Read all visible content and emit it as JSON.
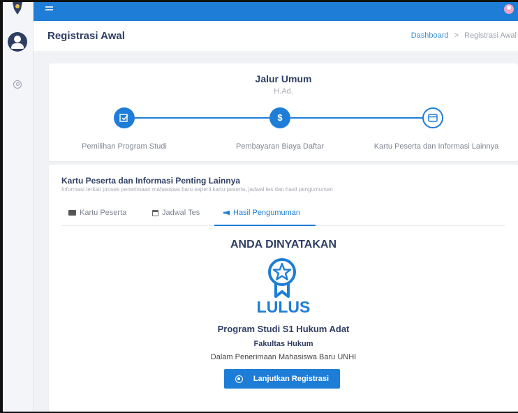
{
  "header": {
    "title": "Registrasi Awal"
  },
  "breadcrumb": {
    "home": "Dashboard",
    "separator": ">",
    "current": "Registrasi Awal"
  },
  "jalur": {
    "title": "Jalur Umum",
    "subtitle": "H.Ad."
  },
  "steps": [
    {
      "label": "Pemilihan Program Studi",
      "icon": "checkbox-icon",
      "state": "completed"
    },
    {
      "label": "Pembayaran Biaya Daftar",
      "icon": "dollar-icon",
      "state": "completed"
    },
    {
      "label": "Kartu Peserta dan Informasi Lainnya",
      "icon": "card-icon",
      "state": "current"
    }
  ],
  "info": {
    "title": "Kartu Peserta dan Informasi Penting Lainnya",
    "subtitle": "Informasi terkait proses penerimaan mahasiswa baru seperti kartu peserta, jadwal tes dan hasil pengumuman"
  },
  "tabs": [
    {
      "label": "Kartu Peserta",
      "icon": "id-card-icon"
    },
    {
      "label": "Jadwal Tes",
      "icon": "calendar-icon"
    },
    {
      "label": "Hasil Pengumuman",
      "icon": "megaphone-icon",
      "active": true
    }
  ],
  "result": {
    "heading": "ANDA DINYATAKAN",
    "status": "LULUS",
    "program": "Program Studi S1 Hukum Adat",
    "faculty": "Fakultas Hukum",
    "description": "Dalam Penerimaan Mahasiswa Baru UNHI",
    "button_label": "Lanjutkan Registrasi"
  },
  "colors": {
    "primary": "#1e7dd7",
    "title": "#2f3e63",
    "background": "#f1f2f6"
  }
}
